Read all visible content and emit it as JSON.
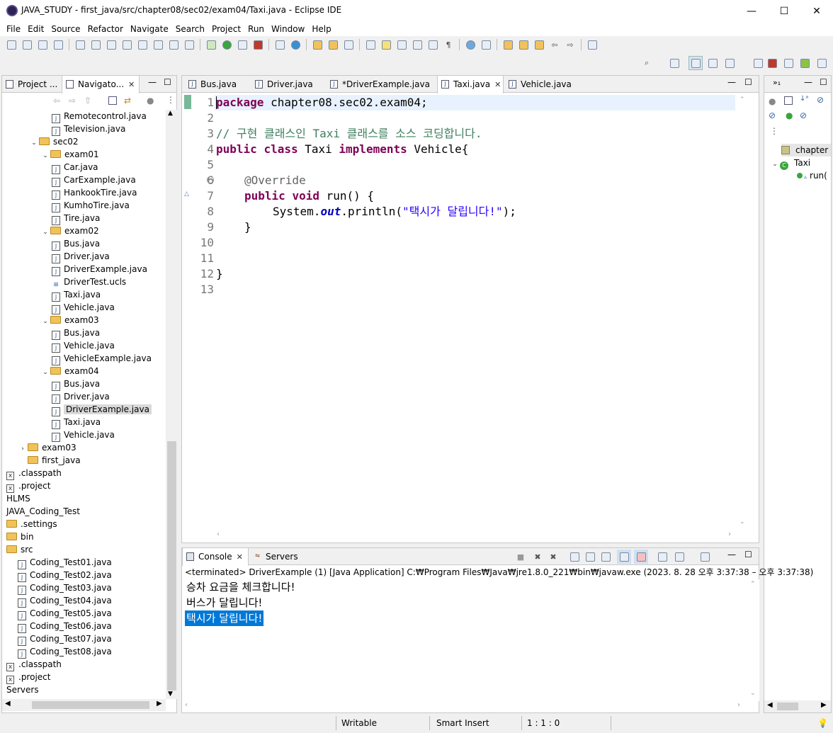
{
  "window": {
    "title": "JAVA_STUDY - first_java/src/chapter08/sec02/exam04/Taxi.java - Eclipse IDE",
    "minimize_glyph": "—",
    "maximize_glyph": "☐",
    "close_glyph": "✕"
  },
  "menu": [
    "File",
    "Edit",
    "Source",
    "Refactor",
    "Navigate",
    "Search",
    "Project",
    "Run",
    "Window",
    "Help"
  ],
  "left_panel": {
    "tabs": [
      "Project ...",
      "Navigato..."
    ],
    "tree": [
      {
        "label": "Remotecontrol.java",
        "type": "java",
        "indent": 3
      },
      {
        "label": "Television.java",
        "type": "java",
        "indent": 3
      },
      {
        "label": "sec02",
        "type": "folder",
        "indent": 1,
        "expanded": true
      },
      {
        "label": "exam01",
        "type": "folder",
        "indent": 2,
        "expanded": true
      },
      {
        "label": "Car.java",
        "type": "java",
        "indent": 3
      },
      {
        "label": "CarExample.java",
        "type": "java",
        "indent": 3
      },
      {
        "label": "HankookTire.java",
        "type": "java",
        "indent": 3
      },
      {
        "label": "KumhoTire.java",
        "type": "java",
        "indent": 3
      },
      {
        "label": "Tire.java",
        "type": "java",
        "indent": 3
      },
      {
        "label": "exam02",
        "type": "folder",
        "indent": 2,
        "expanded": true
      },
      {
        "label": "Bus.java",
        "type": "java",
        "indent": 3
      },
      {
        "label": "Driver.java",
        "type": "java",
        "indent": 3
      },
      {
        "label": "DriverExample.java",
        "type": "java",
        "indent": 3
      },
      {
        "label": "DriverTest.ucls",
        "type": "ucls",
        "indent": 3
      },
      {
        "label": "Taxi.java",
        "type": "java",
        "indent": 3
      },
      {
        "label": "Vehicle.java",
        "type": "java",
        "indent": 3
      },
      {
        "label": "exam03",
        "type": "folder",
        "indent": 2,
        "expanded": true
      },
      {
        "label": "Bus.java",
        "type": "java",
        "indent": 3
      },
      {
        "label": "Vehicle.java",
        "type": "java",
        "indent": 3
      },
      {
        "label": "VehicleExample.java",
        "type": "java",
        "indent": 3
      },
      {
        "label": "exam04",
        "type": "folder",
        "indent": 2,
        "expanded": true
      },
      {
        "label": "Bus.java",
        "type": "java",
        "indent": 3
      },
      {
        "label": "Driver.java",
        "type": "java",
        "indent": 3
      },
      {
        "label": "DriverExample.java",
        "type": "java",
        "indent": 3,
        "selected": true
      },
      {
        "label": "Taxi.java",
        "type": "java",
        "indent": 3
      },
      {
        "label": "Vehicle.java",
        "type": "java",
        "indent": 3
      },
      {
        "label": "exam03",
        "type": "folder",
        "indent": 0,
        "collapsed": true
      },
      {
        "label": "first_java",
        "type": "folder",
        "indent": 0
      },
      {
        "label": ".classpath",
        "type": "xml",
        "indent": -1
      },
      {
        "label": ".project",
        "type": "xml",
        "indent": -1
      },
      {
        "label": "HLMS",
        "type": "plain",
        "indent": -1
      },
      {
        "label": "JAVA_Coding_Test",
        "type": "plain",
        "indent": -1
      },
      {
        "label": ".settings",
        "type": "folder",
        "indent": -1
      },
      {
        "label": "bin",
        "type": "folder",
        "indent": -1
      },
      {
        "label": "src",
        "type": "folder",
        "indent": -1
      },
      {
        "label": "Coding_Test01.java",
        "type": "java",
        "indent": 0
      },
      {
        "label": "Coding_Test02.java",
        "type": "java",
        "indent": 0
      },
      {
        "label": "Coding_Test03.java",
        "type": "java",
        "indent": 0
      },
      {
        "label": "Coding_Test04.java",
        "type": "java",
        "indent": 0
      },
      {
        "label": "Coding_Test05.java",
        "type": "java",
        "indent": 0
      },
      {
        "label": "Coding_Test06.java",
        "type": "java",
        "indent": 0
      },
      {
        "label": "Coding_Test07.java",
        "type": "java",
        "indent": 0
      },
      {
        "label": "Coding_Test08.java",
        "type": "java",
        "indent": 0
      },
      {
        "label": ".classpath",
        "type": "xml",
        "indent": -1
      },
      {
        "label": ".project",
        "type": "xml",
        "indent": -1
      },
      {
        "label": "Servers",
        "type": "plain",
        "indent": -1
      }
    ]
  },
  "editor": {
    "tabs": [
      {
        "label": "Bus.java",
        "active": false
      },
      {
        "label": "Driver.java",
        "active": false
      },
      {
        "label": "*DriverExample.java",
        "active": false
      },
      {
        "label": "Taxi.java",
        "active": true
      },
      {
        "label": "Vehicle.java",
        "active": false
      }
    ],
    "line_numbers": [
      "1",
      "2",
      "3",
      "4",
      "5",
      "6",
      "7",
      "8",
      "9",
      "10",
      "11",
      "12",
      "13"
    ],
    "code": {
      "l1_kw": "package",
      "l1_rest": " chapter08.sec02.exam04;",
      "l3_comment": "// 구현 클래스인 Taxi 클래스를 소스 코딩합니다.",
      "l4_kw1": "public",
      "l4_kw2": "class",
      "l4_name": " Taxi ",
      "l4_kw3": "implements",
      "l4_rest": " Vehicle{",
      "l6_annot": "@Override",
      "l7_kw1": "public",
      "l7_kw2": "void",
      "l7_rest": " run() {",
      "l8_a": "System.",
      "l8_field": "out",
      "l8_b": ".println(",
      "l8_str": "\"택시가 달립니다!\"",
      "l8_c": ");",
      "l9": "}",
      "l12": "}"
    }
  },
  "outline": {
    "items": [
      "chapter",
      "Taxi",
      "run("
    ]
  },
  "console": {
    "tabs": [
      "Console",
      "Servers"
    ],
    "header": "<terminated> DriverExample (1) [Java Application] C:₩Program Files₩Java₩jre1.8.0_221₩bin₩javaw.exe  (2023. 8. 28 오후 3:37:38 – 오후 3:37:38)",
    "lines": [
      "승차 요금을 체크합니다!",
      "버스가 달립니다!",
      "택시가 달립니다!"
    ]
  },
  "status": {
    "mode": "Writable",
    "insert": "Smart Insert",
    "position": "1 : 1 : 0"
  }
}
